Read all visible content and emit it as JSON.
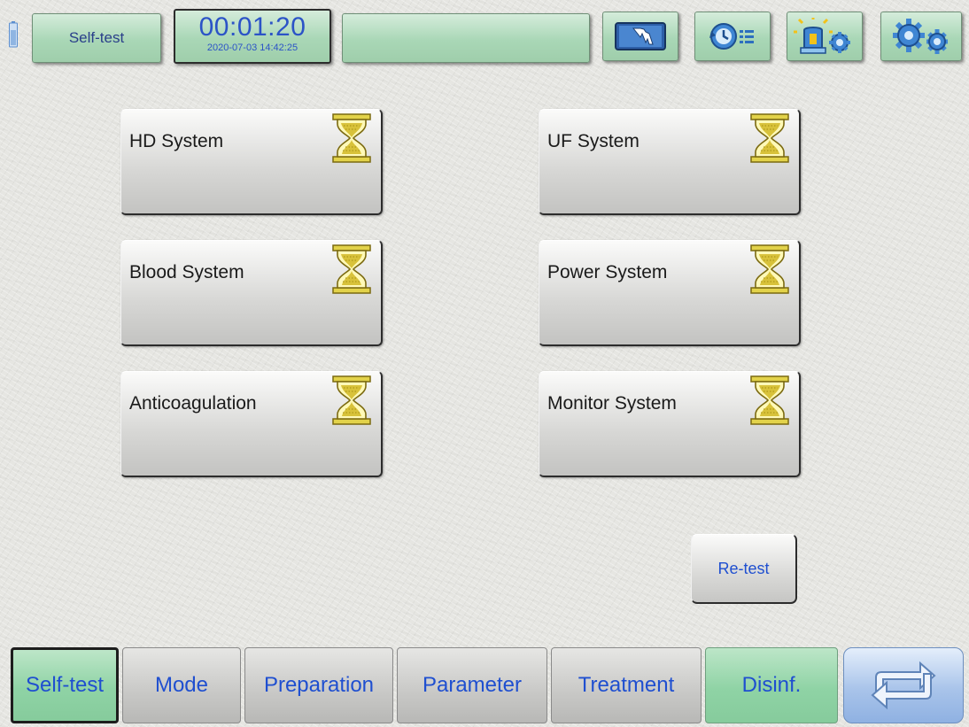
{
  "header": {
    "title": "Self-test",
    "timer": "00:01:20",
    "datetime": "2020-07-03 14:42:25",
    "message": "",
    "icons": [
      "hand-touch-icon",
      "history-list-icon",
      "lamp-settings-icon",
      "gears-icon"
    ]
  },
  "tests": [
    {
      "label": "HD System",
      "status_icon": "hourglass-icon"
    },
    {
      "label": "UF System",
      "status_icon": "hourglass-icon"
    },
    {
      "label": "Blood System",
      "status_icon": "hourglass-icon"
    },
    {
      "label": "Power System",
      "status_icon": "hourglass-icon"
    },
    {
      "label": "Anticoagulation",
      "status_icon": "hourglass-icon"
    },
    {
      "label": "Monitor System",
      "status_icon": "hourglass-icon"
    }
  ],
  "retest_label": "Re-test",
  "nav": [
    {
      "label": "Self-test",
      "active": true
    },
    {
      "label": "Mode"
    },
    {
      "label": "Preparation"
    },
    {
      "label": "Parameter"
    },
    {
      "label": "Treatment"
    },
    {
      "label": "Disinf."
    }
  ],
  "switch_icon": "switch-arrows-icon",
  "colors": {
    "accent_green": "#a9d7b6",
    "text_blue": "#1f4fd0",
    "hourglass_gold": "#d8c23a"
  }
}
